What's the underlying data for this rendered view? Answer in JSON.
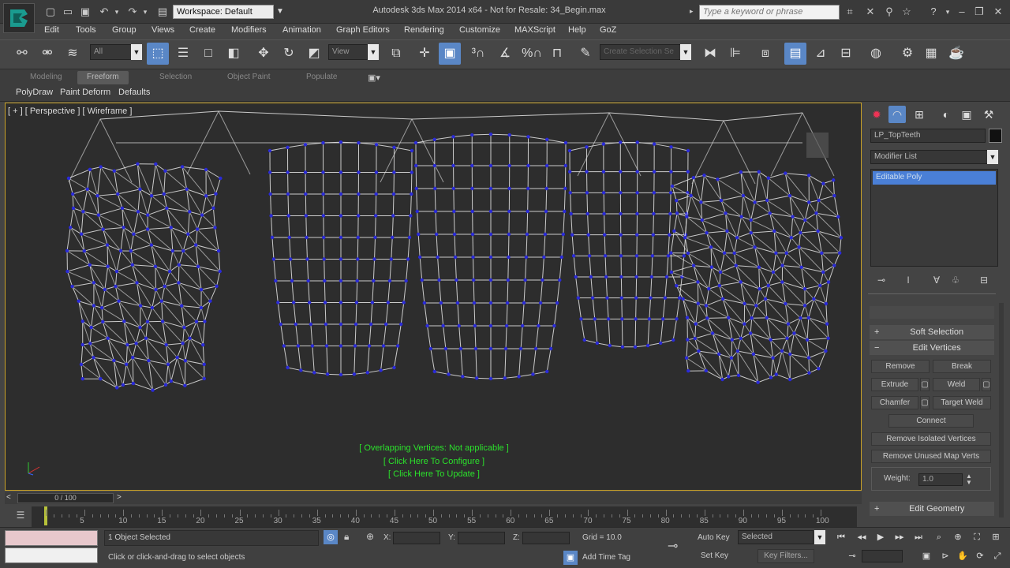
{
  "title_bar": {
    "workspace": "Workspace: Default",
    "app_title": "Autodesk 3ds Max  2014 x64    - Not for Resale:  34_Begin.max",
    "search_placeholder": "Type a keyword or phrase"
  },
  "menu": [
    "Edit",
    "Tools",
    "Group",
    "Views",
    "Create",
    "Modifiers",
    "Animation",
    "Graph Editors",
    "Rendering",
    "Customize",
    "MAXScript",
    "Help",
    "GoZ"
  ],
  "toolbar": {
    "selection_filter": "All",
    "ref_coord": "View",
    "named_selection": "Create Selection Se"
  },
  "ribbon": {
    "tabs": [
      "Modeling",
      "Freeform",
      "Selection",
      "Object Paint",
      "Populate"
    ],
    "selected_tab": "Freeform",
    "sub_items": [
      "PolyDraw",
      "Paint Deform",
      "Defaults"
    ]
  },
  "viewport": {
    "label": "[ + ] [ Perspective ] [ Wireframe ]",
    "messages": [
      "[ Overlapping Vertices: Not applicable ]",
      "[ Click Here To Configure ]",
      "[ Click Here To Update ]"
    ]
  },
  "command_panel": {
    "object_name": "LP_TopTeeth",
    "modifier_list": "Modifier List",
    "stack_item": "Editable Poly",
    "soft_selection": "Soft Selection",
    "edit_vertices": "Edit Vertices",
    "buttons": {
      "remove": "Remove",
      "break": "Break",
      "extrude": "Extrude",
      "weld": "Weld",
      "chamfer": "Chamfer",
      "target_weld": "Target Weld",
      "connect": "Connect",
      "remove_isolated": "Remove Isolated Vertices",
      "remove_unused": "Remove Unused Map Verts"
    },
    "weight_label": "Weight:",
    "weight_value": "1.0",
    "edit_geometry": "Edit Geometry"
  },
  "timeline": {
    "slider": "0 / 100",
    "ticks": [
      "5",
      "10",
      "15",
      "20",
      "25",
      "30",
      "35",
      "40",
      "45",
      "50",
      "55",
      "60",
      "65",
      "70",
      "75",
      "80",
      "85",
      "90",
      "95",
      "100"
    ]
  },
  "status": {
    "selected": "1 Object Selected",
    "prompt": "Click or click-and-drag to select objects",
    "x_label": "X:",
    "y_label": "Y:",
    "z_label": "Z:",
    "grid": "Grid = 10.0",
    "add_time_tag": "Add Time Tag",
    "auto_key": "Auto Key",
    "set_key": "Set Key",
    "key_mode": "Selected",
    "key_filters": "Key Filters..."
  },
  "colors": {
    "accent": "#5a87c6",
    "viewport_border": "#c9a227",
    "vertex": "#2a2ad8",
    "message": "#2be12b"
  }
}
